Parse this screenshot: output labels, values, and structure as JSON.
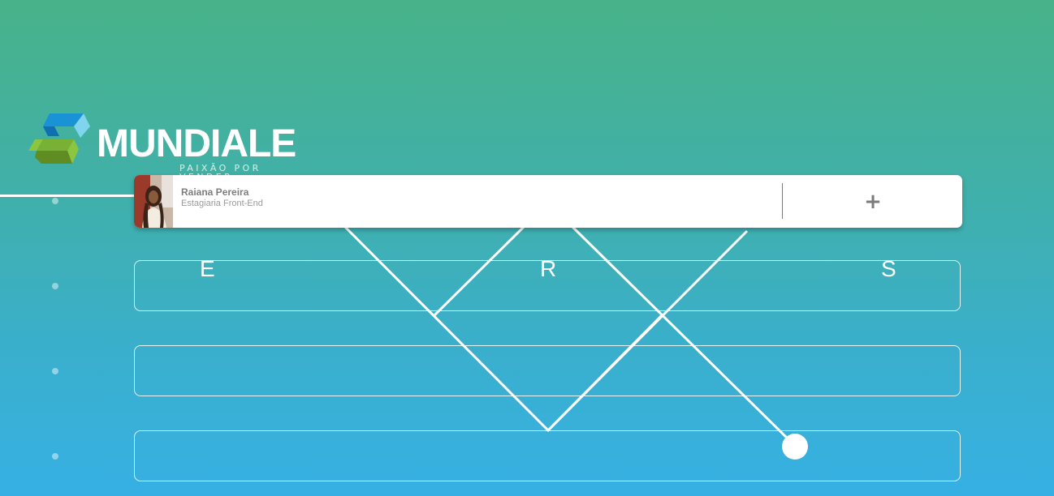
{
  "brand": {
    "name": "MUNDIALE",
    "slogan": "PAIXÃO POR VENDER",
    "colors": {
      "blue": "#1a93d6",
      "light_blue": "#6fd0f0",
      "green": "#6f9e2a",
      "light_green": "#8cc540"
    }
  },
  "profile": {
    "name": "Raiana Pereira",
    "role": "Estagiaria Front-End",
    "add_label": "+"
  },
  "board": {
    "letters": [
      "E",
      "R",
      "S"
    ]
  },
  "colors": {
    "background_top": "#48b389",
    "background_bottom": "#36b0e4",
    "line": "#ffffff"
  }
}
